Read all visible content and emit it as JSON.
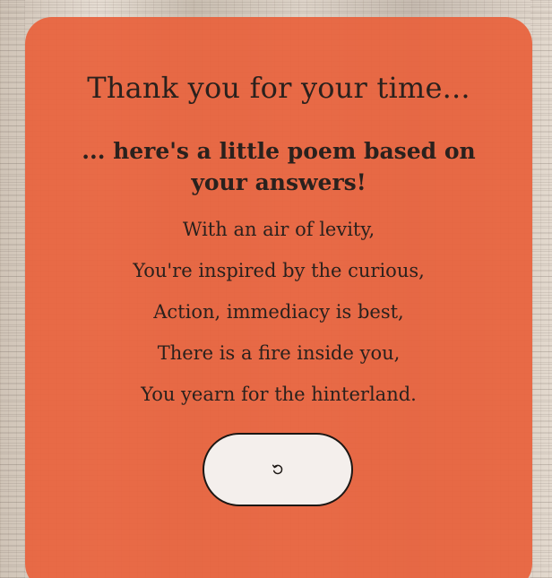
{
  "card": {
    "title": "Thank you for your time...",
    "subtitle": "... here's a little poem based on your answers!",
    "poem_lines": [
      "With an air of levity,",
      "You're inspired by the curious,",
      "Action, immediacy is best,",
      "There is a fire inside you,",
      "You yearn for the hinterland."
    ],
    "restart_icon": "restart-icon"
  },
  "colors": {
    "card_background": "#e8623c",
    "button_background": "#f4efec",
    "text": "#2a211d"
  }
}
